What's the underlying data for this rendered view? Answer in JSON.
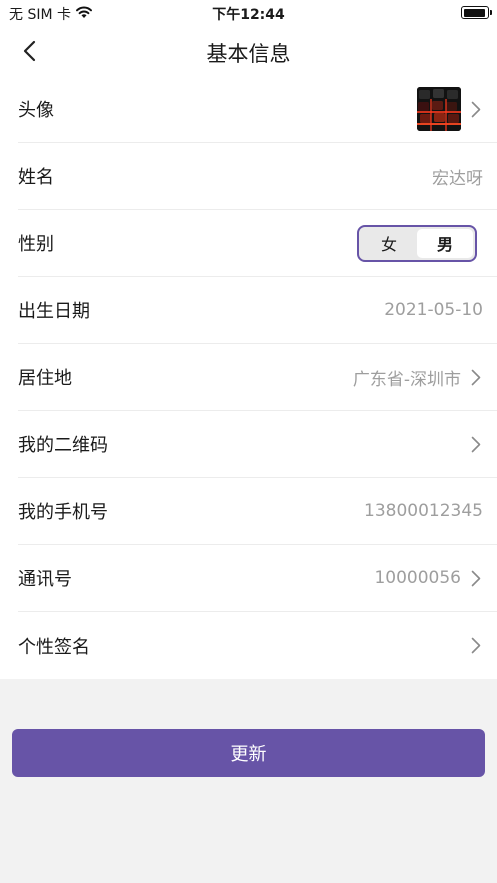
{
  "status_bar": {
    "carrier": "无 SIM 卡",
    "time": "下午12:44",
    "battery_level": 0.95
  },
  "nav": {
    "title": "基本信息"
  },
  "rows": {
    "avatar": {
      "label": "头像"
    },
    "name": {
      "label": "姓名",
      "value": "宏达呀"
    },
    "gender": {
      "label": "性别",
      "options": [
        "女",
        "男"
      ],
      "selected": "男"
    },
    "birthday": {
      "label": "出生日期",
      "value": "2021-05-10"
    },
    "residence": {
      "label": "居住地",
      "value": "广东省-深圳市"
    },
    "qrcode": {
      "label": "我的二维码"
    },
    "phone": {
      "label": "我的手机号",
      "value": "13800012345"
    },
    "account_id": {
      "label": "通讯号",
      "value": "10000056"
    },
    "signature": {
      "label": "个性签名"
    }
  },
  "update_button": {
    "label": "更新"
  },
  "colors": {
    "accent": "#6754a7",
    "background": "#f2f2f2",
    "value_text": "#9e9e9e"
  }
}
